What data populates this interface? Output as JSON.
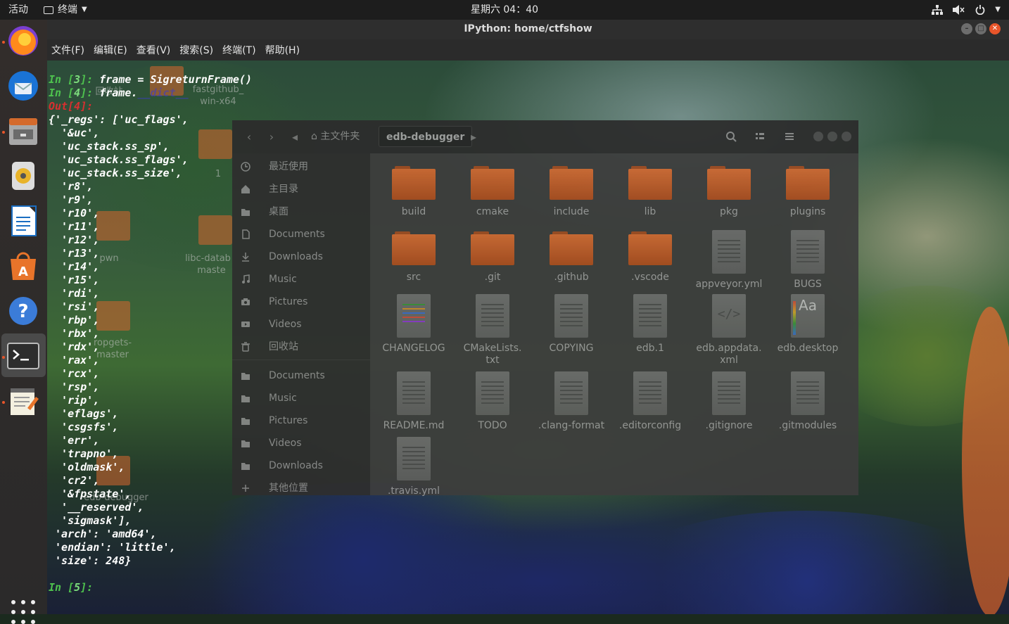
{
  "topbar": {
    "activities": "活动",
    "app_name": "终端",
    "clock": "星期六 04：40"
  },
  "terminal": {
    "title": "IPython: home/ctfshow",
    "menu": [
      "文件(F)",
      "编辑(E)",
      "查看(V)",
      "搜索(S)",
      "终端(T)",
      "帮助(H)"
    ],
    "lines": [
      {
        "prompt": "In [",
        "num": "3",
        "close": "]: ",
        "code": "frame = SigreturnFrame()"
      },
      {
        "prompt": "In [",
        "num": "4",
        "close": "]: ",
        "code": "frame.",
        "dim": "__dict__"
      },
      {
        "out": "Out[4]:"
      },
      {
        "text": "{'_regs': ['uc_flags',"
      },
      {
        "text": "  '&uc',"
      },
      {
        "text": "  'uc_stack.ss_sp',"
      },
      {
        "text": "  'uc_stack.ss_flags',"
      },
      {
        "text": "  'uc_stack.ss_size',"
      },
      {
        "text": "  'r8',"
      },
      {
        "text": "  'r9',"
      },
      {
        "text": "  'r10',"
      },
      {
        "text": "  'r11',"
      },
      {
        "text": "  'r12',"
      },
      {
        "text": "  'r13',"
      },
      {
        "text": "  'r14',"
      },
      {
        "text": "  'r15',"
      },
      {
        "text": "  'rdi',"
      },
      {
        "text": "  'rsi',"
      },
      {
        "text": "  'rbp',"
      },
      {
        "text": "  'rbx',"
      },
      {
        "text": "  'rdx',"
      },
      {
        "text": "  'rax',"
      },
      {
        "text": "  'rcx',"
      },
      {
        "text": "  'rsp',"
      },
      {
        "text": "  'rip',"
      },
      {
        "text": "  'eflags',"
      },
      {
        "text": "  'csgsfs',"
      },
      {
        "text": "  'err',"
      },
      {
        "text": "  'trapno',"
      },
      {
        "text": "  'oldmask',"
      },
      {
        "text": "  'cr2',"
      },
      {
        "text": "  '&fpstate',"
      },
      {
        "text": "  '__reserved',"
      },
      {
        "text": "  'sigmask'],"
      },
      {
        "text": " 'arch': 'amd64',"
      },
      {
        "text": " 'endian': 'little',"
      },
      {
        "text": " 'size': 248}"
      },
      {
        "text": ""
      },
      {
        "prompt": "In [",
        "num": "5",
        "close": "]: ",
        "code": ""
      }
    ]
  },
  "desktop_labels": {
    "trash": "回收站",
    "fastgithub": "fastgithub_",
    "fastgithub2": "win-x64",
    "pwn": "pwn",
    "libc1": "libc-datab",
    "libc2": "maste",
    "count": "1",
    "rop1": "ropgets-",
    "rop2": "master",
    "edb": "edb-debugger"
  },
  "file_manager": {
    "breadcrumbs": [
      "主文件夹",
      "edb-debugger"
    ],
    "sidebar": [
      {
        "label": "最近使用",
        "icon": "clock-icon"
      },
      {
        "label": "主目录",
        "icon": "home-icon"
      },
      {
        "label": "桌面",
        "icon": "folder-icon"
      },
      {
        "label": "Documents",
        "icon": "document-icon"
      },
      {
        "label": "Downloads",
        "icon": "download-icon"
      },
      {
        "label": "Music",
        "icon": "music-icon"
      },
      {
        "label": "Pictures",
        "icon": "camera-icon"
      },
      {
        "label": "Videos",
        "icon": "video-icon"
      },
      {
        "label": "回收站",
        "icon": "trash-icon"
      },
      {
        "label": "Documents",
        "icon": "folder-icon"
      },
      {
        "label": "Music",
        "icon": "folder-icon"
      },
      {
        "label": "Pictures",
        "icon": "folder-icon"
      },
      {
        "label": "Videos",
        "icon": "folder-icon"
      },
      {
        "label": "Downloads",
        "icon": "folder-icon"
      },
      {
        "label": "其他位置",
        "icon": "plus-icon"
      }
    ],
    "items": [
      {
        "name": "build",
        "kind": "folder"
      },
      {
        "name": "cmake",
        "kind": "folder"
      },
      {
        "name": "include",
        "kind": "folder"
      },
      {
        "name": "lib",
        "kind": "folder"
      },
      {
        "name": "pkg",
        "kind": "folder"
      },
      {
        "name": "plugins",
        "kind": "folder"
      },
      {
        "name": "src",
        "kind": "folder"
      },
      {
        "name": ".git",
        "kind": "folder"
      },
      {
        "name": ".github",
        "kind": "folder"
      },
      {
        "name": ".vscode",
        "kind": "folder"
      },
      {
        "name": "appveyor.yml",
        "kind": "doc"
      },
      {
        "name": "BUGS",
        "kind": "doc"
      },
      {
        "name": "CHANGELOG",
        "kind": "doc-color"
      },
      {
        "name": "CMakeLists.\ntxt",
        "kind": "doc"
      },
      {
        "name": "COPYING",
        "kind": "doc"
      },
      {
        "name": "edb.1",
        "kind": "doc"
      },
      {
        "name": "edb.appdata.\nxml",
        "kind": "doc-code"
      },
      {
        "name": "edb.desktop",
        "kind": "doc-font"
      },
      {
        "name": "README.md",
        "kind": "doc"
      },
      {
        "name": "TODO",
        "kind": "doc"
      },
      {
        "name": ".clang-format",
        "kind": "doc"
      },
      {
        "name": ".editorconfig",
        "kind": "doc"
      },
      {
        "name": ".gitignore",
        "kind": "doc"
      },
      {
        "name": ".gitmodules",
        "kind": "doc"
      },
      {
        "name": ".travis.yml",
        "kind": "doc"
      }
    ]
  },
  "colors": {
    "prompt_green": "#4ec24e",
    "out_red": "#d73030",
    "folder_orange": "#d06a33",
    "close_orange": "#e8552a"
  }
}
